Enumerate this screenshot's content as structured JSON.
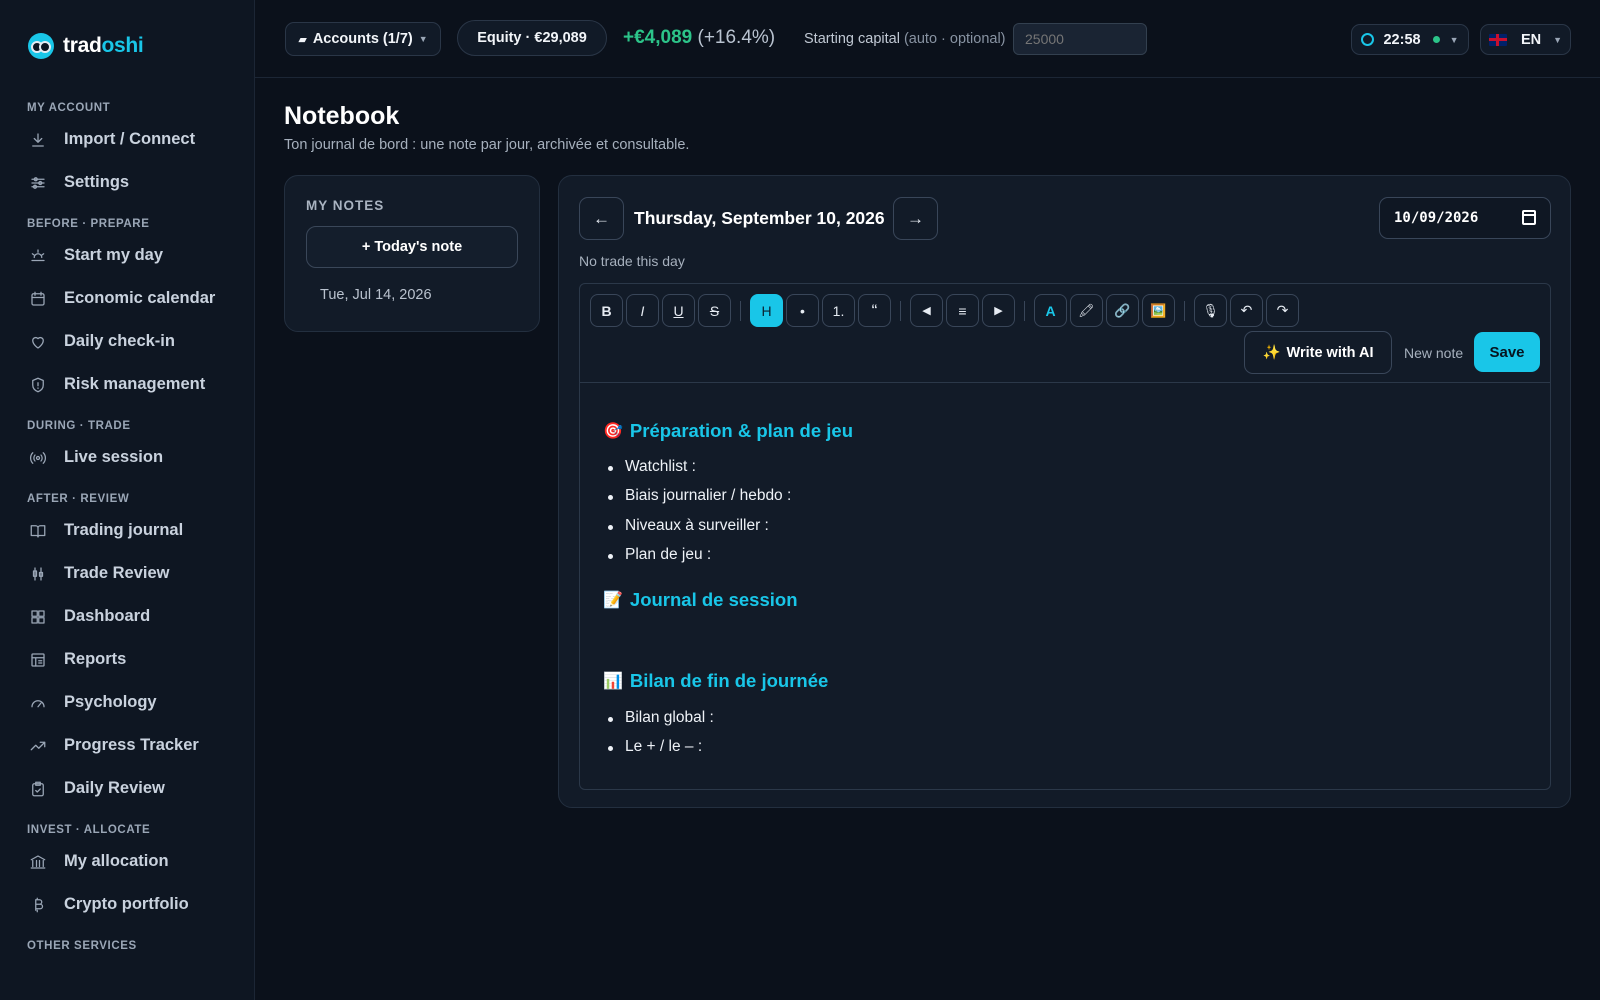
{
  "brand": {
    "part1": "trad",
    "part2": "oshi"
  },
  "sidebar": {
    "sections": [
      {
        "title": "MY ACCOUNT",
        "items": [
          {
            "label": "Import / Connect",
            "icon": "download-icon"
          },
          {
            "label": "Settings",
            "icon": "sliders-icon"
          }
        ]
      },
      {
        "title": "BEFORE · PREPARE",
        "items": [
          {
            "label": "Start my day",
            "icon": "sunrise-icon"
          },
          {
            "label": "Economic calendar",
            "icon": "calendar-icon"
          },
          {
            "label": "Daily check-in",
            "icon": "heart-icon"
          },
          {
            "label": "Risk management",
            "icon": "shield-icon"
          }
        ]
      },
      {
        "title": "DURING · TRADE",
        "items": [
          {
            "label": "Live session",
            "icon": "broadcast-icon"
          }
        ]
      },
      {
        "title": "AFTER · REVIEW",
        "items": [
          {
            "label": "Trading journal",
            "icon": "book-icon"
          },
          {
            "label": "Trade Review",
            "icon": "candles-icon"
          },
          {
            "label": "Dashboard",
            "icon": "grid-icon"
          },
          {
            "label": "Reports",
            "icon": "report-icon"
          },
          {
            "label": "Psychology",
            "icon": "gauge-icon"
          },
          {
            "label": "Progress Tracker",
            "icon": "trending-up-icon"
          },
          {
            "label": "Daily Review",
            "icon": "clipboard-check-icon"
          }
        ]
      },
      {
        "title": "INVEST · ALLOCATE",
        "items": [
          {
            "label": "My allocation",
            "icon": "bank-icon"
          },
          {
            "label": "Crypto portfolio",
            "icon": "bitcoin-icon"
          }
        ]
      },
      {
        "title": "OTHER SERVICES",
        "items": []
      }
    ]
  },
  "topbar": {
    "accounts": "Accounts (1/7)",
    "equity": "Equity · €29,089",
    "pnl_value": "+€4,089",
    "pnl_pct": "(+16.4%)",
    "capital_label": "Starting capital",
    "capital_hint": "(auto · optional)",
    "capital_placeholder": "25000",
    "clock": "22:58",
    "language": "EN"
  },
  "page": {
    "title": "Notebook",
    "subtitle": "Ton journal de bord : une note par jour, archivée et consultable."
  },
  "notes": {
    "title": "MY NOTES",
    "today_button": "+ Today's note",
    "entries": [
      "Tue, Jul 14, 2026"
    ]
  },
  "editor": {
    "prev": "←",
    "next": "→",
    "date_heading": "Thursday, September 10, 2026",
    "date_value": "10/09/2026",
    "no_trade": "No trade this day",
    "toolbar": {
      "bold": "B",
      "italic": "I",
      "underline": "U",
      "strike": "S",
      "heading": "H",
      "bullet": "•",
      "ordered": "1.",
      "quote": "“",
      "align_left": "◀",
      "align_center": "≡",
      "align_right": "▶",
      "color": "A",
      "highlight": "🖍",
      "link": "🔗",
      "image": "🖼️",
      "mic": "🎙",
      "undo": "↶",
      "redo": "↷"
    },
    "ai_button": "Write with AI",
    "ai_emoji": "✨",
    "new_note": "New note",
    "save": "Save",
    "content": {
      "sections": [
        {
          "emoji": "🎯",
          "heading": "Préparation & plan de jeu",
          "bullets": [
            "Watchlist :",
            "Biais journalier / hebdo :",
            "Niveaux à surveiller :",
            "Plan de jeu :"
          ]
        },
        {
          "emoji": "📝",
          "heading": "Journal de session",
          "bullets": []
        },
        {
          "emoji": "📊",
          "heading": "Bilan de fin de journée",
          "bullets": [
            "Bilan global :",
            "Le + / le – :"
          ]
        }
      ]
    }
  },
  "colors": {
    "accent": "#19c6e8",
    "positive": "#2cc489",
    "background": "#0b111b"
  }
}
